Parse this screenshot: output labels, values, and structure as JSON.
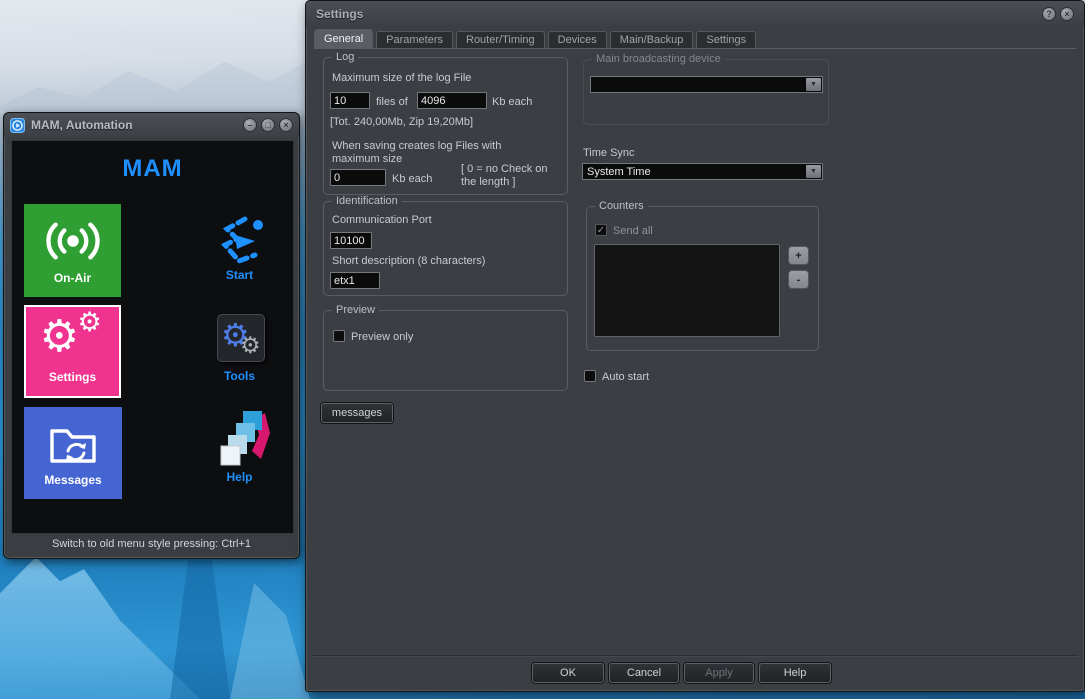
{
  "icons": {
    "help_glyph": "?",
    "close_glyph": "×",
    "minimize_glyph": "–",
    "maximize_glyph": "□",
    "dropdown_arrow": "▼",
    "check": "✓",
    "gear": "⚙"
  },
  "mam_window": {
    "title": "MAM, Automation",
    "logo": "MAM",
    "tiles": {
      "on_air": "On-Air",
      "start": "Start",
      "settings": "Settings",
      "tools": "Tools",
      "messages": "Messages",
      "help": "Help"
    },
    "status_text": "Switch to old menu style pressing: Ctrl+1",
    "colors": {
      "on_air": "#2f9e33",
      "settings": "#f0338f",
      "messages": "#4565d2",
      "accent_blue": "#1e90ff"
    }
  },
  "settings_window": {
    "title": "Settings",
    "tabs": [
      "General",
      "Parameters",
      "Router/Timing",
      "Devices",
      "Main/Backup",
      "Settings"
    ],
    "active_tab": "General",
    "log_group": {
      "title": "Log",
      "max_size_label": "Maximum size of the log File",
      "files_value": "10",
      "files_of_label": "files of",
      "kb_value": "4096",
      "kb_each_label": "Kb each",
      "total_label": "[Tot. 240,00Mb, Zip 19,20Mb]",
      "when_saving_line1": "When saving creates log Files with",
      "when_saving_line2": "maximum size",
      "max_kb_value": "0",
      "kb_each_label2": "Kb each",
      "zero_note_line1": "[ 0 = no Check on",
      "zero_note_line2": "the length ]"
    },
    "identification_group": {
      "title": "Identification",
      "port_label": "Communication Port",
      "port_value": "10100",
      "description_label": "Short description (8 characters)",
      "description_value": "etx1"
    },
    "preview_group": {
      "title": "Preview",
      "preview_only_label": "Preview only",
      "preview_only_checked": false
    },
    "messages_button_label": "messages",
    "broadcast_group": {
      "title": "Main broadcasting device",
      "device_value": "",
      "disabled": true
    },
    "time_sync": {
      "label": "Time Sync",
      "value": "System Time"
    },
    "counters_group": {
      "title": "Counters",
      "send_all_label": "Send all",
      "send_all_checked": true,
      "plus_label": "+",
      "minus_label": "-",
      "list_items": []
    },
    "auto_start_label": "Auto start",
    "auto_start_checked": false,
    "footer_buttons": {
      "ok": "OK",
      "cancel": "Cancel",
      "apply": "Apply",
      "help": "Help"
    }
  }
}
